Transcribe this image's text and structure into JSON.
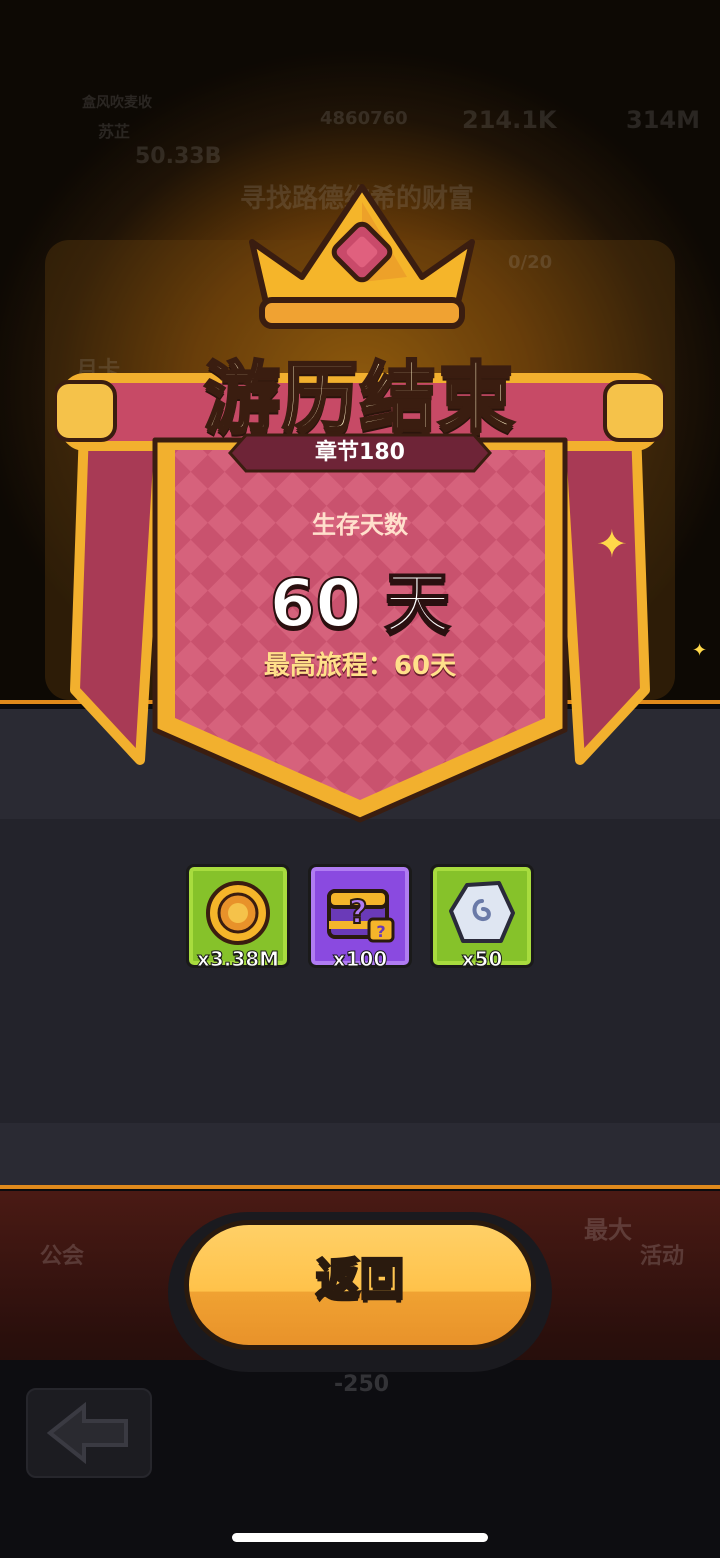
{
  "background": {
    "player_label": "盒风吹麦收",
    "player_sub": "苏芷",
    "stat_power": "4860760",
    "stat_gold": "214.1K",
    "stat_gem": "314M",
    "stat_coins": "50.33B",
    "quest_title": "寻找路德维希的财富",
    "quest_progress": "0/20",
    "month_card": "月卡",
    "guild_label": "公会",
    "activity_label": "活动",
    "max_label": "最大",
    "energy_cost": "-250"
  },
  "result": {
    "title": "游历结束",
    "chapter": "章节180",
    "survive_label": "生存天数",
    "days": "60 天",
    "best_record": "最高旅程：60天"
  },
  "rewards": [
    {
      "name": "gold-coin",
      "qty": "x3.38M",
      "color": "#86c22a"
    },
    {
      "name": "mystery-chest",
      "qty": "x100",
      "color": "#8a4ae0"
    },
    {
      "name": "rune-stone",
      "qty": "x50",
      "color": "#86c22a"
    }
  ],
  "actions": {
    "return_label": "返回"
  },
  "colors": {
    "accent_orange": "#e08a1c",
    "banner_pink": "#c9526e",
    "gold": "#f5b52a",
    "button_yellow": "#ffc24a"
  }
}
